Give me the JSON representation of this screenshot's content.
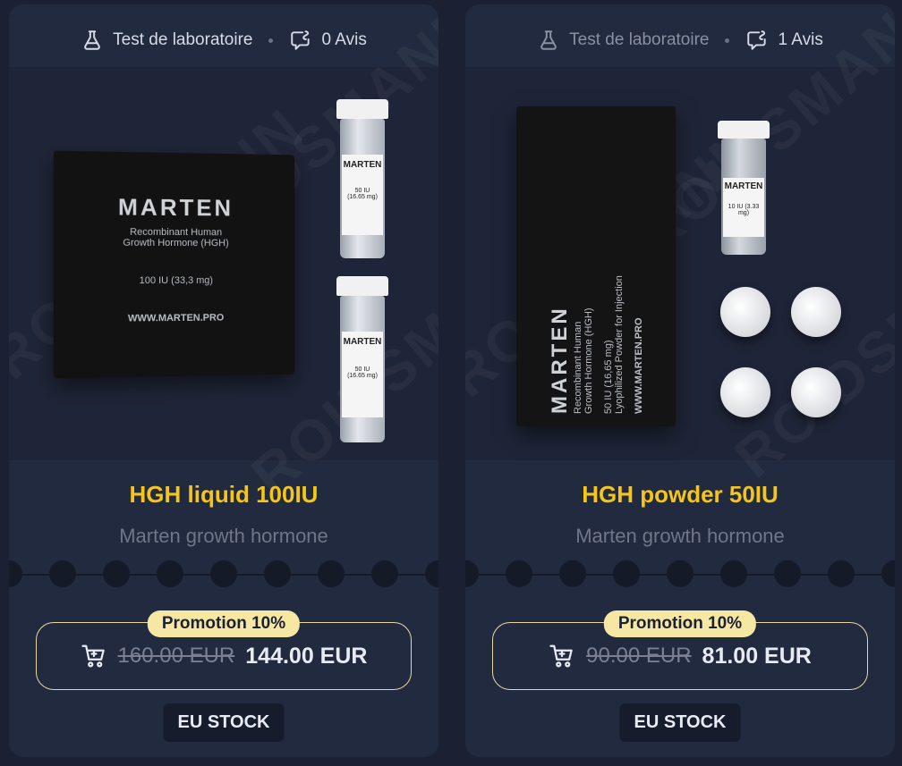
{
  "products": [
    {
      "lab_label": "Test de laboratoire",
      "reviews": "0 Avis",
      "title": "HGH liquid 100IU",
      "subtitle": "Marten growth hormone",
      "promo": "Promotion 10%",
      "old_price": "160.00 EUR",
      "new_price": "144.00 EUR",
      "stock": "EU STOCK",
      "packaging": {
        "brand": "MARTEN",
        "box_line1": "Recombinant Human",
        "box_line2": "Growth Hormone (HGH)",
        "box_dose": "100 IU (33,3 mg)",
        "box_site": "WWW.MARTEN.PRO",
        "vial_dose": "50 IU",
        "vial_mg": "(16.65 mg)"
      }
    },
    {
      "lab_label": "Test de laboratoire",
      "reviews": "1 Avis",
      "title": "HGH powder 50IU",
      "subtitle": "Marten growth hormone",
      "promo": "Promotion 10%",
      "old_price": "90.00 EUR",
      "new_price": "81.00 EUR",
      "stock": "EU STOCK",
      "packaging": {
        "brand": "MARTEN",
        "box_line1": "Recombinant Human",
        "box_line2": "Growth Hormone (HGH)",
        "box_dose": "50 IU (16,65 mg)",
        "box_desc": "Lyophilized Powder for Injection",
        "box_site": "WWW.MARTEN.PRO",
        "vial_dose": "10 IU (3.33 mg)"
      }
    }
  ],
  "watermark": "ROIDSMANN",
  "colors": {
    "background": "#1b2133",
    "card": "#222a3f",
    "title": "#f5c518",
    "promo_badge": "#f6e7a3",
    "price_border": "#e7d8a0"
  },
  "icons": [
    "flask-icon",
    "review-chat-icon",
    "cart-icon"
  ]
}
